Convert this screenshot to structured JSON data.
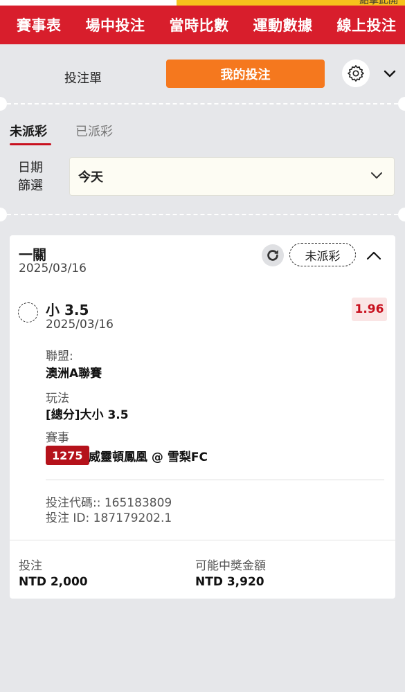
{
  "top_strip": {
    "text": "點擊此開"
  },
  "nav": {
    "items": [
      "賽事表",
      "場中投注",
      "當時比數",
      "運動數據",
      "線上投注"
    ]
  },
  "bet_panel": {
    "tab_bet_slip": "投注單",
    "tab_my_bets": "我的投注",
    "settings_icon": "gear-icon",
    "collapse_icon": "chevron-down-icon"
  },
  "sub_tabs": {
    "unsettled": "未派彩",
    "settled": "已派彩"
  },
  "date_filter": {
    "label_line1": "日期",
    "label_line2": "篩選",
    "selected": "今天"
  },
  "bet_card": {
    "type": "一關",
    "date": "2025/03/16",
    "status": "未派彩",
    "selection": {
      "name": "小 3.5",
      "date": "2025/03/16",
      "odds": "1.96"
    },
    "league_label": "聯盟:",
    "league_value": "澳洲A聯賽",
    "market_label": "玩法",
    "market_value": "[總分]大小 3.5",
    "event_label": "賽事",
    "event_id": "1275",
    "event_name": "威靈頓鳳凰 @ 雪梨FC",
    "bet_code": "投注代碼:: 165183809",
    "bet_id": "投注 ID: 187179202.1",
    "stake_label": "投注",
    "stake_value": "NTD 2,000",
    "payout_label": "可能中獎金額",
    "payout_value": "NTD 3,920"
  },
  "colors": {
    "nav_red": "#d81e2c",
    "my_bets_orange": "#f5781e",
    "odds_red": "#c8101e",
    "event_badge": "#b5121b"
  }
}
